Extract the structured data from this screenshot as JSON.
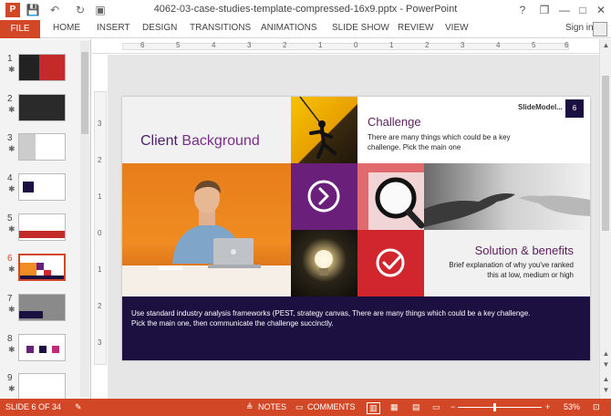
{
  "window": {
    "title": "4062-03-case-studies-template-compressed-16x9.pptx - PowerPoint",
    "app_logo": "P",
    "quick_access": {
      "save": "💾",
      "undo": "↶",
      "redo": "↻",
      "present": "▣"
    },
    "buttons": {
      "help": "?",
      "restore": "❐",
      "minimize": "—",
      "maximize": "□",
      "close": "✕"
    }
  },
  "ribbon": {
    "tabs": [
      "FILE",
      "HOME",
      "INSERT",
      "DESIGN",
      "TRANSITIONS",
      "ANIMATIONS",
      "SLIDE SHOW",
      "REVIEW",
      "VIEW"
    ],
    "sign_in": "Sign in"
  },
  "thumbnails": [
    {
      "num": "1",
      "star": "✱",
      "active": false
    },
    {
      "num": "2",
      "star": "✱",
      "active": false
    },
    {
      "num": "3",
      "star": "✱",
      "active": false
    },
    {
      "num": "4",
      "star": "✱",
      "active": false
    },
    {
      "num": "5",
      "star": "✱",
      "active": false
    },
    {
      "num": "6",
      "star": "✱",
      "active": true
    },
    {
      "num": "7",
      "star": "✱",
      "active": false
    },
    {
      "num": "8",
      "star": "✱",
      "active": false
    },
    {
      "num": "9",
      "star": "✱",
      "active": false
    }
  ],
  "ruler": {
    "h_labels": [
      "6",
      "5",
      "4",
      "3",
      "2",
      "1",
      "0",
      "1",
      "2",
      "3",
      "4",
      "5",
      "6"
    ],
    "v_labels": [
      "3",
      "2",
      "1",
      "0",
      "1",
      "2",
      "3"
    ]
  },
  "slide": {
    "title": {
      "part1": "Client ",
      "part2": "Background"
    },
    "challenge": {
      "heading": "Challenge",
      "text": "There are many things which could be a key challenge. Pick the main one"
    },
    "logo": "SlideModel...",
    "slide_number": "6",
    "solution": {
      "heading_part1": "Solution ",
      "heading_part2": "& benefits",
      "text": "Brief explanation of why you've ranked this at low, medium or high"
    },
    "footer_text": "Use standard industry analysis frameworks (PEST, strategy canvas, There are many things which could be a key challenge. Pick the main one, then communicate the challenge succinctly."
  },
  "colors": {
    "accent": "#d24726",
    "purple": "#6a1f7a",
    "navy": "#1b1040",
    "red": "#d1262e",
    "title_purple": "#5a1e5a"
  },
  "statusbar": {
    "slide_info": "SLIDE 6 OF 34",
    "notes": "NOTES",
    "comments": "COMMENTS",
    "zoom_minus": "−",
    "zoom_plus": "+",
    "zoom": "53%",
    "zoom_level": 0.53
  }
}
